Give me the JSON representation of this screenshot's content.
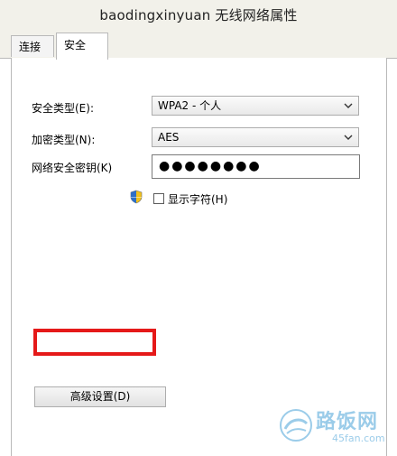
{
  "window": {
    "title": "baodingxinyuan 无线网络属性"
  },
  "tabs": [
    {
      "label": "连接",
      "active": false
    },
    {
      "label": "安全",
      "active": true
    }
  ],
  "form": {
    "security_type_label": "安全类型(E):",
    "security_type_value": "WPA2 - 个人",
    "encryption_type_label": "加密类型(N):",
    "encryption_type_value": "AES",
    "key_label": "网络安全密钥(K)",
    "key_value": "●●●●●●●●",
    "show_chars_label": "显示字符(H)",
    "show_chars_checked": false
  },
  "buttons": {
    "advanced_label": "高级设置(D)"
  },
  "watermark": {
    "text": "路饭网",
    "sub": "45fan.com"
  },
  "colors": {
    "highlight": "#e51919"
  },
  "icons": {
    "shield": "uac-shield-icon",
    "dropdown": "chevron-down-icon"
  }
}
